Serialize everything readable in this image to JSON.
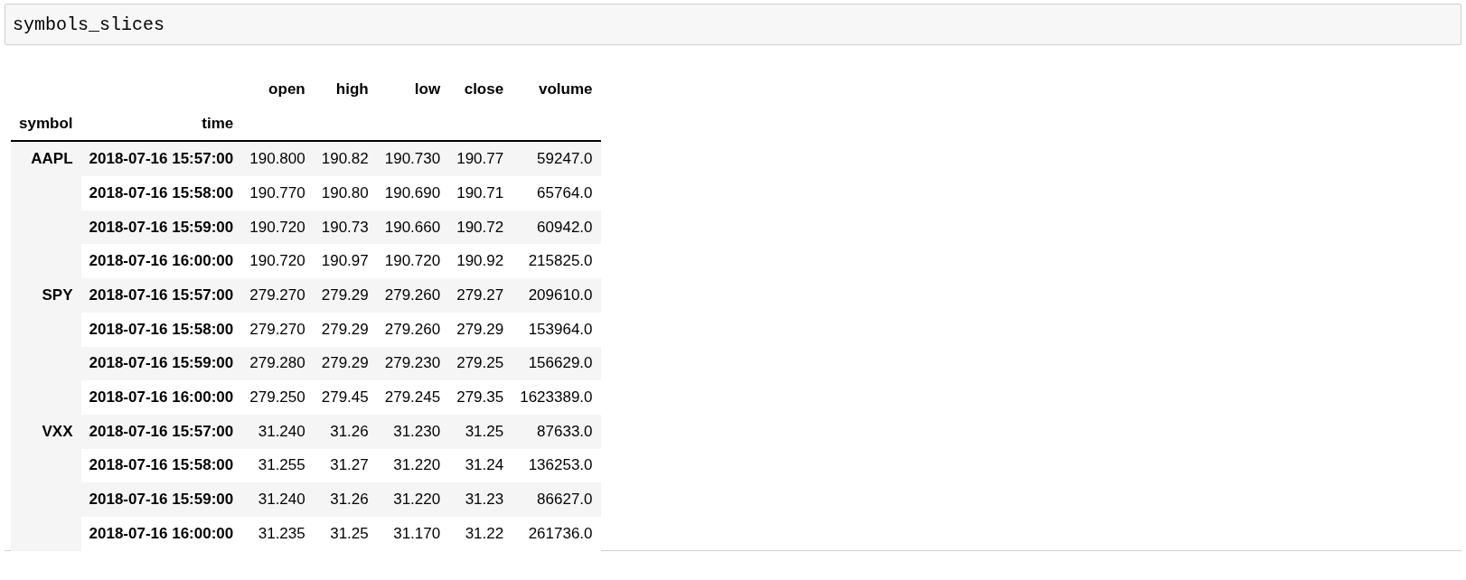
{
  "input_cell": {
    "code": "symbols_slices"
  },
  "table": {
    "columns": [
      "open",
      "high",
      "low",
      "close",
      "volume"
    ],
    "index_names": [
      "symbol",
      "time"
    ],
    "groups": [
      {
        "symbol": "AAPL",
        "rows": [
          {
            "time": "2018-07-16 15:57:00",
            "values": [
              "190.800",
              "190.82",
              "190.730",
              "190.77",
              "59247.0"
            ]
          },
          {
            "time": "2018-07-16 15:58:00",
            "values": [
              "190.770",
              "190.80",
              "190.690",
              "190.71",
              "65764.0"
            ]
          },
          {
            "time": "2018-07-16 15:59:00",
            "values": [
              "190.720",
              "190.73",
              "190.660",
              "190.72",
              "60942.0"
            ]
          },
          {
            "time": "2018-07-16 16:00:00",
            "values": [
              "190.720",
              "190.97",
              "190.720",
              "190.92",
              "215825.0"
            ]
          }
        ]
      },
      {
        "symbol": "SPY",
        "rows": [
          {
            "time": "2018-07-16 15:57:00",
            "values": [
              "279.270",
              "279.29",
              "279.260",
              "279.27",
              "209610.0"
            ]
          },
          {
            "time": "2018-07-16 15:58:00",
            "values": [
              "279.270",
              "279.29",
              "279.260",
              "279.29",
              "153964.0"
            ]
          },
          {
            "time": "2018-07-16 15:59:00",
            "values": [
              "279.280",
              "279.29",
              "279.230",
              "279.25",
              "156629.0"
            ]
          },
          {
            "time": "2018-07-16 16:00:00",
            "values": [
              "279.250",
              "279.45",
              "279.245",
              "279.35",
              "1623389.0"
            ]
          }
        ]
      },
      {
        "symbol": "VXX",
        "rows": [
          {
            "time": "2018-07-16 15:57:00",
            "values": [
              "31.240",
              "31.26",
              "31.230",
              "31.25",
              "87633.0"
            ]
          },
          {
            "time": "2018-07-16 15:58:00",
            "values": [
              "31.255",
              "31.27",
              "31.220",
              "31.24",
              "136253.0"
            ]
          },
          {
            "time": "2018-07-16 15:59:00",
            "values": [
              "31.240",
              "31.26",
              "31.220",
              "31.23",
              "86627.0"
            ]
          },
          {
            "time": "2018-07-16 16:00:00",
            "values": [
              "31.235",
              "31.25",
              "31.170",
              "31.22",
              "261736.0"
            ]
          }
        ]
      }
    ]
  }
}
